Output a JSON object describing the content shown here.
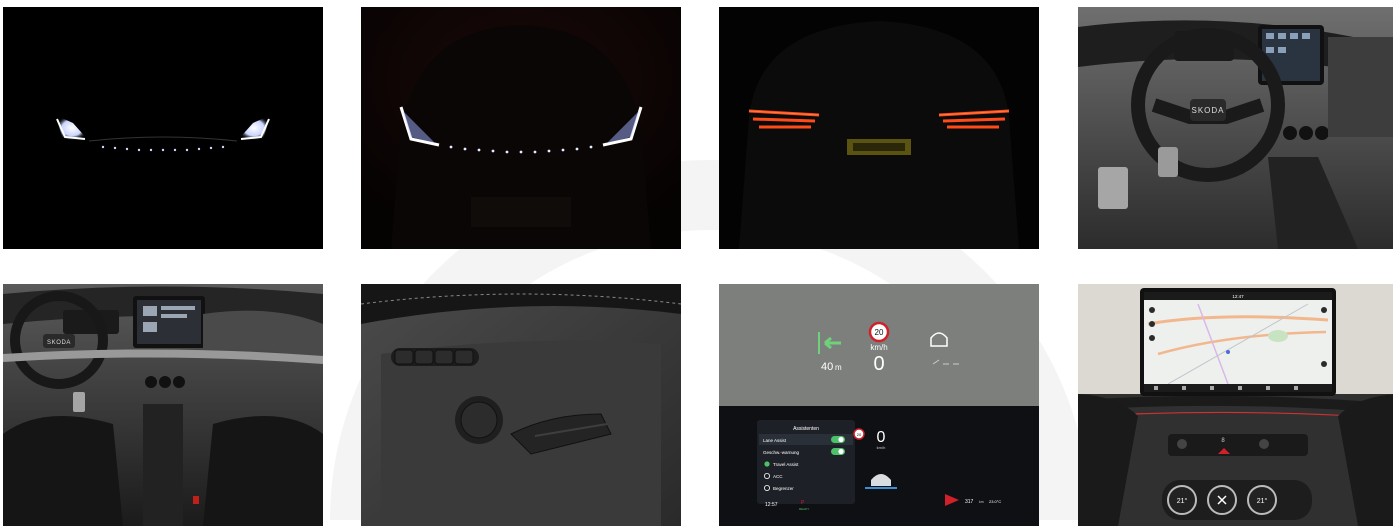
{
  "gallery": {
    "brand_logo": "SKODA",
    "hud": {
      "distance": "40",
      "distance_unit": "m",
      "speed_limit": "20",
      "speed_unit": "km/h",
      "speed": "0"
    },
    "cluster": {
      "menu_title": "Assistenten",
      "menu_items": [
        {
          "label": "Lane Assist",
          "toggle": "on"
        },
        {
          "label": "Geschw.-warnung",
          "toggle": "on"
        },
        {
          "label": "Travel Assist",
          "radio": "selected"
        },
        {
          "label": "ACC",
          "radio": "unselected"
        },
        {
          "label": "Begrenzer",
          "radio": "unselected"
        }
      ],
      "speed_limit": "20",
      "speed": "0",
      "speed_unit": "km/h",
      "clock": "12:57",
      "gear": "P",
      "ready": "READY",
      "range": "317",
      "range_unit": "km",
      "temperature": "23.0°C"
    },
    "infotainment": {
      "clock": "12:47",
      "fan_level": "8",
      "temp_left": "21°",
      "temp_right": "21°"
    }
  }
}
